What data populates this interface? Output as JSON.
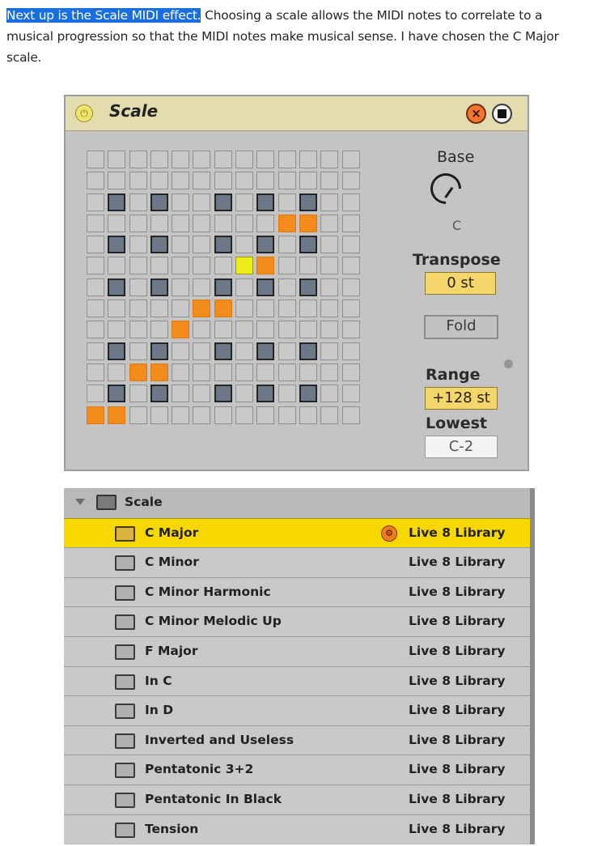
{
  "intro": {
    "highlight": "Next up is the Scale MIDI effect.",
    "rest": " Choosing a scale allows the MIDI notes to correlate to a musical progression so that the MIDI notes make musical sense. I have chosen the C Major scale."
  },
  "device": {
    "title": "Scale",
    "power_glyph": "⏻",
    "close_glyph": "×",
    "base_label": "Base",
    "base_value": "C",
    "transpose_label": "Transpose",
    "transpose_value": "0 st",
    "fold_label": "Fold",
    "range_label": "Range",
    "range_value": "+128 st",
    "lowest_label": "Lowest",
    "lowest_value": "C-2",
    "grid": {
      "rows": 13,
      "cols": 13,
      "dark_rows": [
        2,
        4,
        6,
        9,
        11
      ],
      "dark_cols": [
        1,
        3,
        6,
        8,
        10
      ],
      "orange_cells": [
        [
          3,
          9
        ],
        [
          3,
          10
        ],
        [
          5,
          8
        ],
        [
          7,
          5
        ],
        [
          7,
          6
        ],
        [
          8,
          4
        ],
        [
          10,
          2
        ],
        [
          10,
          3
        ],
        [
          12,
          0
        ],
        [
          12,
          1
        ]
      ],
      "yellow_cells": [
        [
          5,
          7
        ]
      ]
    },
    "colors": {
      "title_bar": "#e3dcae",
      "orange": "#f28a1c",
      "yellow": "#ecec1a",
      "dark": "#6c7888"
    }
  },
  "browser": {
    "folder_name": "Scale",
    "items": [
      {
        "name": "C Major",
        "source": "Live 8 Library",
        "selected": true
      },
      {
        "name": "C Minor",
        "source": "Live 8 Library",
        "selected": false
      },
      {
        "name": "C Minor Harmonic",
        "source": "Live 8 Library",
        "selected": false
      },
      {
        "name": "C Minor Melodic Up",
        "source": "Live 8 Library",
        "selected": false
      },
      {
        "name": "F Major",
        "source": "Live 8 Library",
        "selected": false
      },
      {
        "name": "In C",
        "source": "Live 8 Library",
        "selected": false
      },
      {
        "name": "In D",
        "source": "Live 8 Library",
        "selected": false
      },
      {
        "name": "Inverted and Useless",
        "source": "Live 8 Library",
        "selected": false
      },
      {
        "name": "Pentatonic 3+2",
        "source": "Live 8 Library",
        "selected": false
      },
      {
        "name": "Pentatonic In Black",
        "source": "Live 8 Library",
        "selected": false
      },
      {
        "name": "Tension",
        "source": "Live 8 Library",
        "selected": false
      }
    ],
    "colors": {
      "selected_row": "#f6d700",
      "row": "#c9c9c9"
    }
  }
}
